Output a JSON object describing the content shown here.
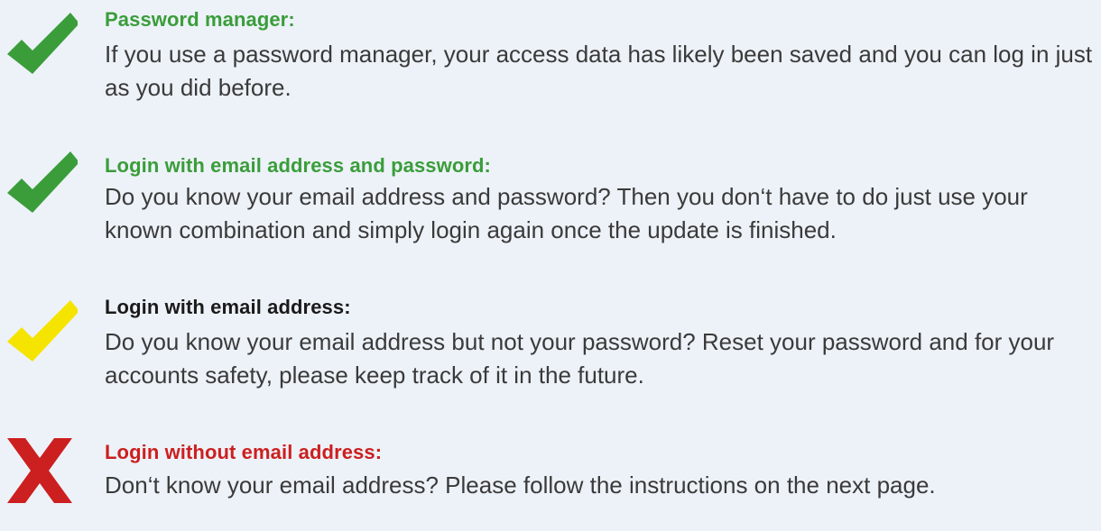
{
  "items": [
    {
      "status": "ok",
      "icon": "check-icon",
      "icon_color": "#3a9d3a",
      "heading": "Password manager:",
      "heading_color": "#3a9d3a",
      "text": "If you use a password manager, your access data has likely been saved and you can log in just as you did before."
    },
    {
      "status": "ok",
      "icon": "check-icon",
      "icon_color": "#3a9d3a",
      "heading": "Login with email address and password:",
      "heading_color": "#3a9d3a",
      "text": "Do you know your email address and password? Then you don‘t have to do just use your known combination and simply login again once the update is finished."
    },
    {
      "status": "warning",
      "icon": "check-icon",
      "icon_color": "#f5e400",
      "heading": "Login with email address:",
      "heading_color": "#1a1a1a",
      "text": "Do you know your email address but not your password? Reset your password and for your accounts safety, please keep track of it in the future."
    },
    {
      "status": "error",
      "icon": "cross-icon",
      "icon_color": "#cc1f1f",
      "heading": "Login without email address:",
      "heading_color": "#cc1f1f",
      "text": "Don‘t know your email address? Please follow the instructions on the next page."
    }
  ]
}
